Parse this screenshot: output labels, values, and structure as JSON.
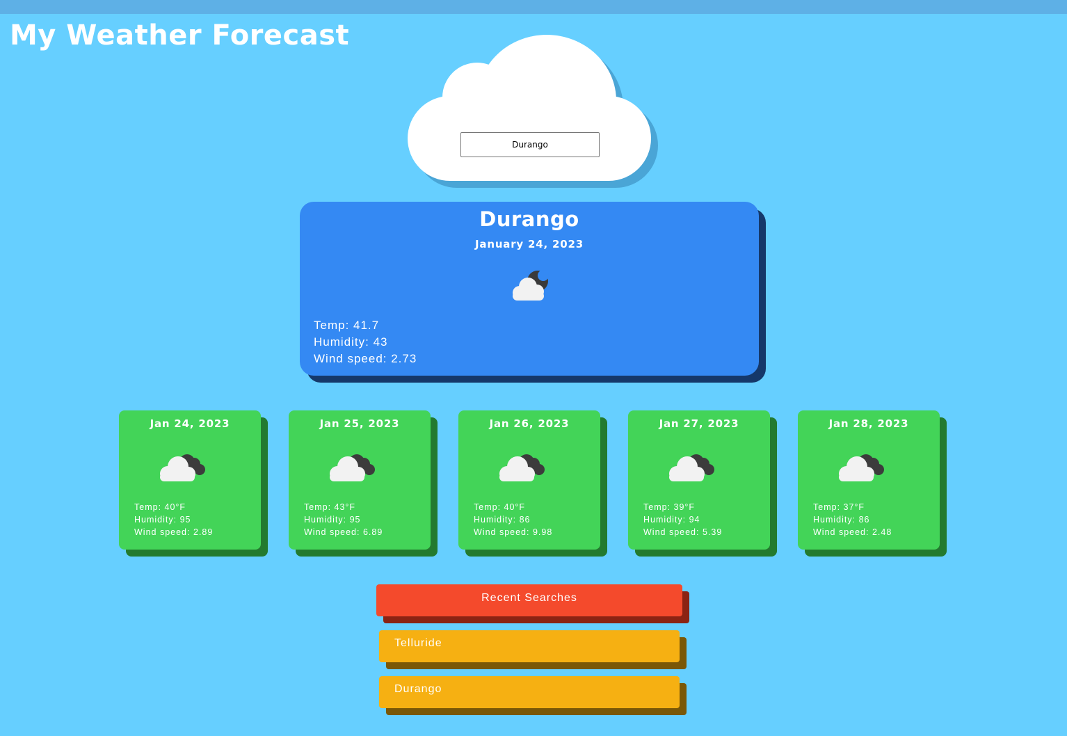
{
  "header": {
    "title": "My Weather Forecast"
  },
  "search": {
    "value": "Durango"
  },
  "current": {
    "city": "Durango",
    "date": "January 24, 2023",
    "icon": "cloud-moon-icon",
    "temp": "Temp: 41.7",
    "humidity": "Humidity: 43",
    "wind": "Wind speed: 2.73"
  },
  "forecast": [
    {
      "date": "Jan 24, 2023",
      "icon": "cloudy-icon",
      "temp": "Temp: 40°F",
      "humidity": "Humidity: 95",
      "wind": "Wind speed: 2.89"
    },
    {
      "date": "Jan 25, 2023",
      "icon": "cloudy-icon",
      "temp": "Temp: 43°F",
      "humidity": "Humidity: 95",
      "wind": "Wind speed: 6.89"
    },
    {
      "date": "Jan 26, 2023",
      "icon": "cloudy-icon",
      "temp": "Temp: 40°F",
      "humidity": "Humidity: 86",
      "wind": "Wind speed: 9.98"
    },
    {
      "date": "Jan 27, 2023",
      "icon": "cloudy-icon",
      "temp": "Temp: 39°F",
      "humidity": "Humidity: 94",
      "wind": "Wind speed: 5.39"
    },
    {
      "date": "Jan 28, 2023",
      "icon": "cloudy-icon",
      "temp": "Temp: 37°F",
      "humidity": "Humidity: 86",
      "wind": "Wind speed: 2.48"
    }
  ],
  "recent": {
    "header": "Recent Searches",
    "items": [
      "Telluride",
      "Durango"
    ]
  },
  "colors": {
    "background": "#66cfff",
    "current_card": "#3489f3",
    "forecast_card": "#43d458",
    "recent_header": "#f44a2c",
    "recent_item": "#f6b012"
  }
}
